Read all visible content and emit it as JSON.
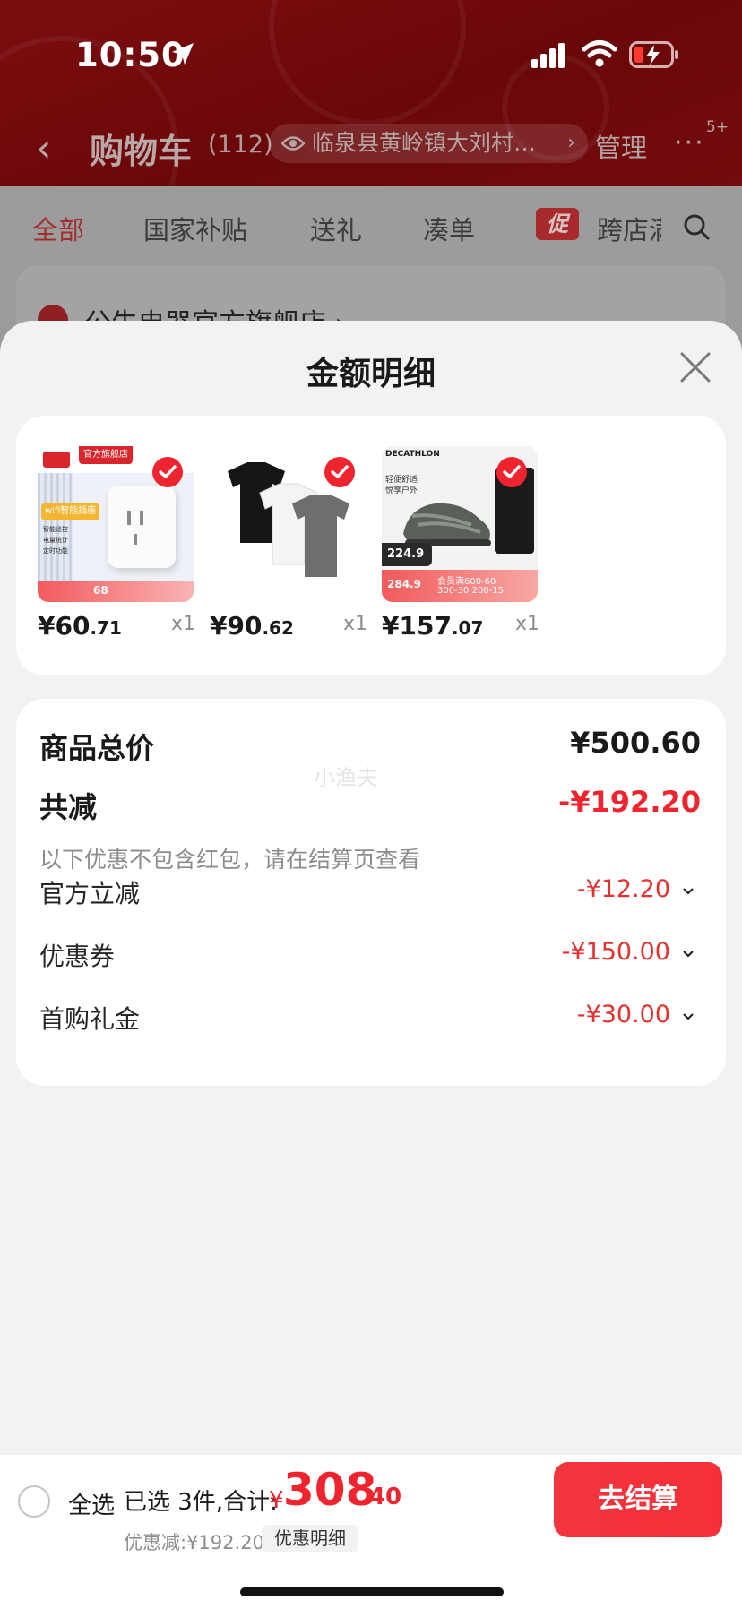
{
  "status_bar": {
    "time": "10:50"
  },
  "nav": {
    "title": "购物车",
    "count": "(112)",
    "address": "临泉县黄岭镇大刘村…",
    "manage": "管理",
    "more_badge": "5+"
  },
  "tabs": [
    {
      "label": "全部"
    },
    {
      "label": "国家补贴"
    },
    {
      "label": "送礼"
    },
    {
      "label": "凑单"
    },
    {
      "label": "跨店满"
    }
  ],
  "promo_badge": "促",
  "background_store": "公牛电器官方旗舰店 ›",
  "sheet": {
    "title": "金额明细",
    "products": [
      {
        "price_int": "¥60",
        "price_dec": ".71",
        "qty": "x1",
        "image_text": [
          "官方旗舰店",
          "wifi智能插座",
          "智能遥控",
          "电量统计",
          "定时功能",
          "68"
        ]
      },
      {
        "price_int": "¥90",
        "price_dec": ".62",
        "qty": "x1"
      },
      {
        "price_int": "¥157",
        "price_dec": ".07",
        "qty": "x1",
        "image_text": [
          "DECATHLON",
          "轻便舒适",
          "悦享户外",
          "224.9",
          "284.9",
          "会员满600-60",
          "300-30 200-15"
        ]
      }
    ],
    "summary": {
      "total_label": "商品总价",
      "total_value": "¥500.60",
      "reduce_label": "共减",
      "reduce_value": "-¥192.20",
      "note": "以下优惠不包含红包，请在结算页查看",
      "details": [
        {
          "label": "官方立减",
          "value": "-¥12.20"
        },
        {
          "label": "优惠券",
          "value": "-¥150.00"
        },
        {
          "label": "首购礼金",
          "value": "-¥30.00"
        }
      ],
      "watermark": "小渔夫"
    }
  },
  "bottom": {
    "select_all": "全选",
    "selected": "已选 3件,合计:",
    "currency": "¥",
    "total_int": "308",
    "total_dec": ".40",
    "discount": "优惠减:¥192.20",
    "detail_chip": "优惠明细",
    "checkout": "去结算"
  },
  "colors": {
    "accent": "#f0242f",
    "header": "#6e080a"
  }
}
